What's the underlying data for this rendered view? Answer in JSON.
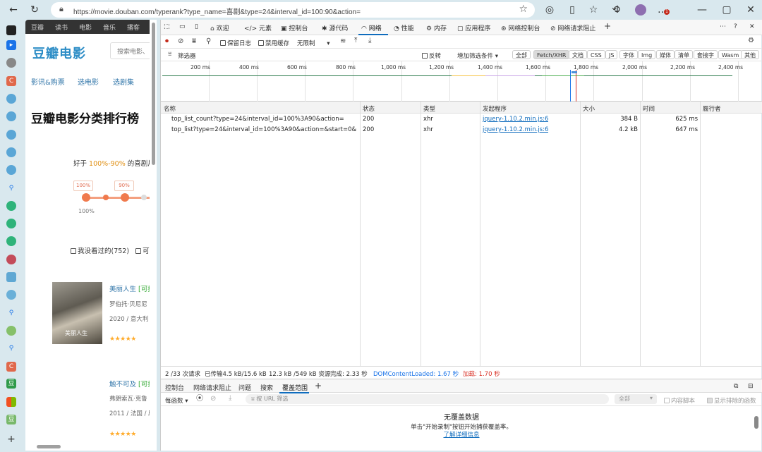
{
  "browser": {
    "url": "https://movie.douban.com/typerank?type_name=喜剧&type=24&interval_id=100:90&action="
  },
  "douban": {
    "nav": [
      "豆瓣",
      "读书",
      "电影",
      "音乐",
      "播客"
    ],
    "logo": "豆瓣电影",
    "search_placeholder": "搜索电影、",
    "subnav": [
      "影讯&购票",
      "选电影",
      "选剧集"
    ],
    "heading": "豆瓣电影分类排行榜",
    "filter_prefix": "好于",
    "filter_range": "100%-90%",
    "filter_suffix": "的喜剧片",
    "slider": {
      "pill_left": "100%",
      "pill_right": "90%",
      "value_label": "100%",
      "range": [
        0.9,
        1.0
      ]
    },
    "checkbox_label": "我没看过的(752)",
    "checkbox_label2": "可",
    "movies": [
      {
        "title": "美丽人生",
        "tag": "[可播",
        "line1": "罗伯托·贝尼尼",
        "line2": "2020 / 意大利",
        "poster_text": "美丽人生",
        "rating_stars": "★★★★★"
      },
      {
        "title": "触不可及",
        "tag": "[可播",
        "line1": "弗朗索瓦·克鲁",
        "line2": "2011 / 法国 / 剧",
        "rating_stars": "★★★★★"
      }
    ]
  },
  "devtools": {
    "tabs": [
      "欢迎",
      "元素",
      "控制台",
      "源代码",
      "网络",
      "性能",
      "内存",
      "应用程序",
      "网络控制台",
      "网络请求阻止"
    ],
    "active_tab": "网络",
    "toolbar": {
      "preserve_log": "保留日志",
      "disable_cache": "禁用缓存",
      "throttle": "无限制"
    },
    "filterbar": {
      "filter_label": "筛选器",
      "invert": "反转",
      "more_filters": "增加筛选条件",
      "types": [
        "全部",
        "Fetch/XHR",
        "文档",
        "CSS",
        "JS",
        "字体",
        "Img",
        "媒体",
        "清单",
        "套接字",
        "Wasm",
        "其他"
      ],
      "active_type": "Fetch/XHR"
    },
    "overview_ticks": [
      "200 ms",
      "400 ms",
      "600 ms",
      "800 ms",
      "1,000 ms",
      "1,200 ms",
      "1,400 ms",
      "1,600 ms",
      "1,800 ms",
      "2,000 ms",
      "2,200 ms",
      "2,400 ms"
    ],
    "columns": [
      "名称",
      "状态",
      "类型",
      "发起程序",
      "大小",
      "时间",
      "履行者"
    ],
    "requests": [
      {
        "name": "top_list_count?type=24&interval_id=100%3A90&action=",
        "status": "200",
        "type": "xhr",
        "initiator": "jquery-1.10.2.min.js:6",
        "size": "384 B",
        "time": "625 ms"
      },
      {
        "name": "top_list?type=24&interval_id=100%3A90&action=&start=0&li...",
        "status": "200",
        "type": "xhr",
        "initiator": "jquery-1.10.2.min.js:6",
        "size": "4.2 kB",
        "time": "647 ms"
      }
    ],
    "summary": {
      "requests": "2 /33 次请求",
      "transferred": "已传输4.5 kB/15.6 kB",
      "resources": "12.3 kB /549 kB 资源",
      "finish": "完成: 2.33 秒",
      "dcl": "DOMContentLoaded: 1.67 秒",
      "load": "加载: 1.70 秒"
    },
    "drawer": {
      "tabs": [
        "控制台",
        "网络请求阻止",
        "问题",
        "搜索",
        "覆盖范围"
      ],
      "active_tab": "覆盖范围",
      "per_function": "每函数",
      "url_filter_placeholder": "按 URL 筛选",
      "all_option": "全部",
      "content_scripts": "内容脚本",
      "show_excluded": "显示排除的函数",
      "empty_title": "无覆盖数据",
      "empty_hint": "单击\"开始录制\"按钮开始捕获覆盖率。",
      "learn_more": "了解详细信息"
    }
  },
  "colors": {
    "accent": "#0f6cbd",
    "douban_blue": "#2d8dc6",
    "slider": "#f07a4d"
  }
}
